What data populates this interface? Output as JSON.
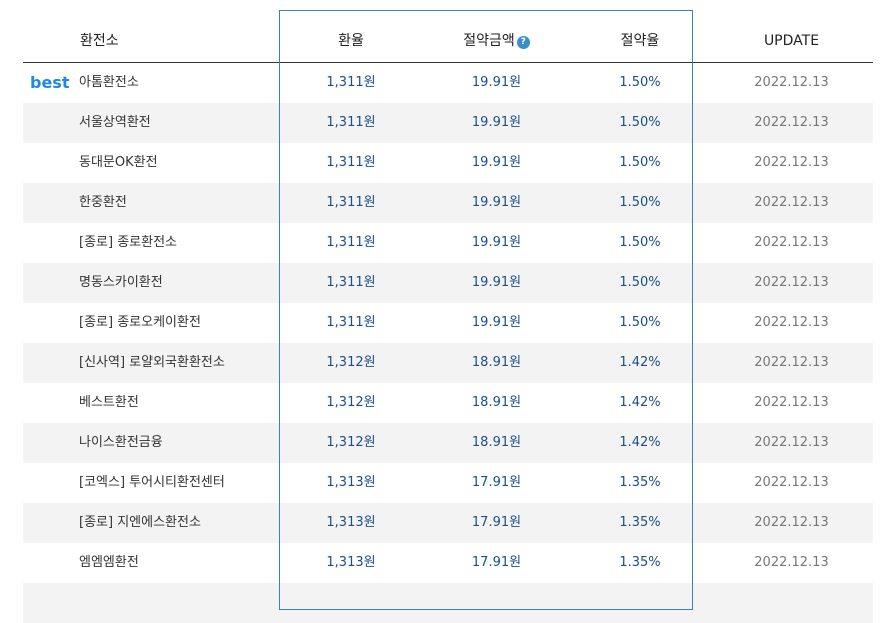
{
  "header": {
    "name": "환전소",
    "rate": "환율",
    "saving": "절약금액",
    "saving_help": "?",
    "percent": "절약율",
    "update": "UPDATE"
  },
  "best_label": "best",
  "accent_color": "#1e88e5",
  "rows": [
    {
      "name": "아톰환전소",
      "rate": "1,311원",
      "saving": "19.91원",
      "percent": "1.50%",
      "update": "2022.12.13"
    },
    {
      "name": "서울상역환전",
      "rate": "1,311원",
      "saving": "19.91원",
      "percent": "1.50%",
      "update": "2022.12.13"
    },
    {
      "name": "동대문OK환전",
      "rate": "1,311원",
      "saving": "19.91원",
      "percent": "1.50%",
      "update": "2022.12.13"
    },
    {
      "name": "한중환전",
      "rate": "1,311원",
      "saving": "19.91원",
      "percent": "1.50%",
      "update": "2022.12.13"
    },
    {
      "name": "[종로] 종로환전소",
      "rate": "1,311원",
      "saving": "19.91원",
      "percent": "1.50%",
      "update": "2022.12.13"
    },
    {
      "name": "명동스카이환전",
      "rate": "1,311원",
      "saving": "19.91원",
      "percent": "1.50%",
      "update": "2022.12.13"
    },
    {
      "name": "[종로] 종로오케이환전",
      "rate": "1,311원",
      "saving": "19.91원",
      "percent": "1.50%",
      "update": "2022.12.13"
    },
    {
      "name": "[신사역] 로얄외국환환전소",
      "rate": "1,312원",
      "saving": "18.91원",
      "percent": "1.42%",
      "update": "2022.12.13"
    },
    {
      "name": "베스트환전",
      "rate": "1,312원",
      "saving": "18.91원",
      "percent": "1.42%",
      "update": "2022.12.13"
    },
    {
      "name": "나이스환전금융",
      "rate": "1,312원",
      "saving": "18.91원",
      "percent": "1.42%",
      "update": "2022.12.13"
    },
    {
      "name": "[코엑스] 투어시티환전센터",
      "rate": "1,313원",
      "saving": "17.91원",
      "percent": "1.35%",
      "update": "2022.12.13"
    },
    {
      "name": "[종로] 지엔에스환전소",
      "rate": "1,313원",
      "saving": "17.91원",
      "percent": "1.35%",
      "update": "2022.12.13"
    },
    {
      "name": "엠엠엠환전",
      "rate": "1,313원",
      "saving": "17.91원",
      "percent": "1.35%",
      "update": "2022.12.13"
    }
  ]
}
